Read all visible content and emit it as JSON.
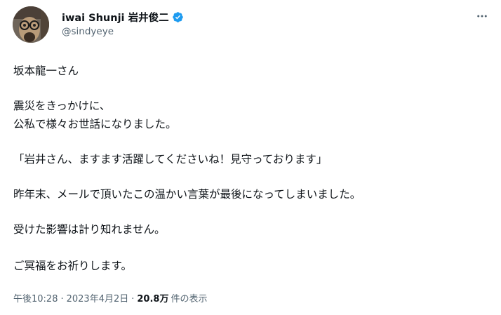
{
  "author": {
    "display_name": "iwai Shunji 岩井俊二",
    "handle": "@sindyeye",
    "verified_color": "#1d9bf0"
  },
  "tweet": {
    "lines": [
      "坂本龍一さん",
      "震災をきっかけに、",
      "公私で様々お世話になりました。",
      "「岩井さん、ますます活躍してくださいね！見守っております」",
      "昨年末、メールで頂いたこの温かい言葉が最後になってしまいました。",
      "受けた影響は計り知れません。",
      "ご冥福をお祈りします。"
    ]
  },
  "footer": {
    "time": "午後10:28",
    "date": "2023年4月2日",
    "separator": "·",
    "views_count": "20.8万",
    "views_label": "件の表示"
  },
  "icons": {
    "more": "more-options-icon",
    "verified": "verified-badge-icon"
  }
}
